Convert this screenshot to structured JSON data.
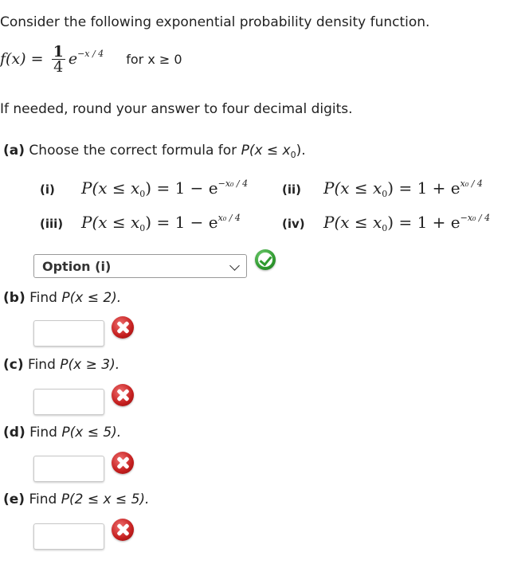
{
  "intro": "Consider the following exponential probability density function.",
  "pdf": {
    "lhs": "f(x)",
    "eq": " = ",
    "frac_num": "1",
    "frac_den": "4",
    "base": "e",
    "exponent": "−x / 4",
    "domain": "for x ≥ 0"
  },
  "rounding_note": "If needed, round your answer to four decimal digits.",
  "part_a": {
    "label": "(a)",
    "text": " Choose the correct formula for ",
    "expr": "P(x ≤ x",
    "expr_sub": "0",
    "expr_end": ").",
    "options": [
      {
        "label": "(i)",
        "lhs": "P(x ≤ x",
        "sub": "0",
        "rhs": ") = 1 − e",
        "exp": "−x₀ / 4"
      },
      {
        "label": "(ii)",
        "lhs": "P(x ≤ x",
        "sub": "0",
        "rhs": ") = 1 + e",
        "exp": "x₀ / 4"
      },
      {
        "label": "(iii)",
        "lhs": "P(x ≤ x",
        "sub": "0",
        "rhs": ") = 1 − e",
        "exp": "x₀ / 4"
      },
      {
        "label": "(iv)",
        "lhs": "P(x ≤ x",
        "sub": "0",
        "rhs": ") = 1 + e",
        "exp": "−x₀ / 4"
      }
    ],
    "selected": "Option (i)",
    "status": "correct"
  },
  "parts": [
    {
      "label": "(b)",
      "text": " Find ",
      "expr": "P(x ≤ 2).",
      "value": "",
      "status": "incorrect"
    },
    {
      "label": "(c)",
      "text": " Find ",
      "expr": "P(x ≥ 3).",
      "value": "",
      "status": "incorrect"
    },
    {
      "label": "(d)",
      "text": " Find ",
      "expr": "P(x ≤ 5).",
      "value": "",
      "status": "incorrect"
    },
    {
      "label": "(e)",
      "text": " Find ",
      "expr": "P(2 ≤ x ≤ 5).",
      "value": "",
      "status": "incorrect"
    }
  ]
}
